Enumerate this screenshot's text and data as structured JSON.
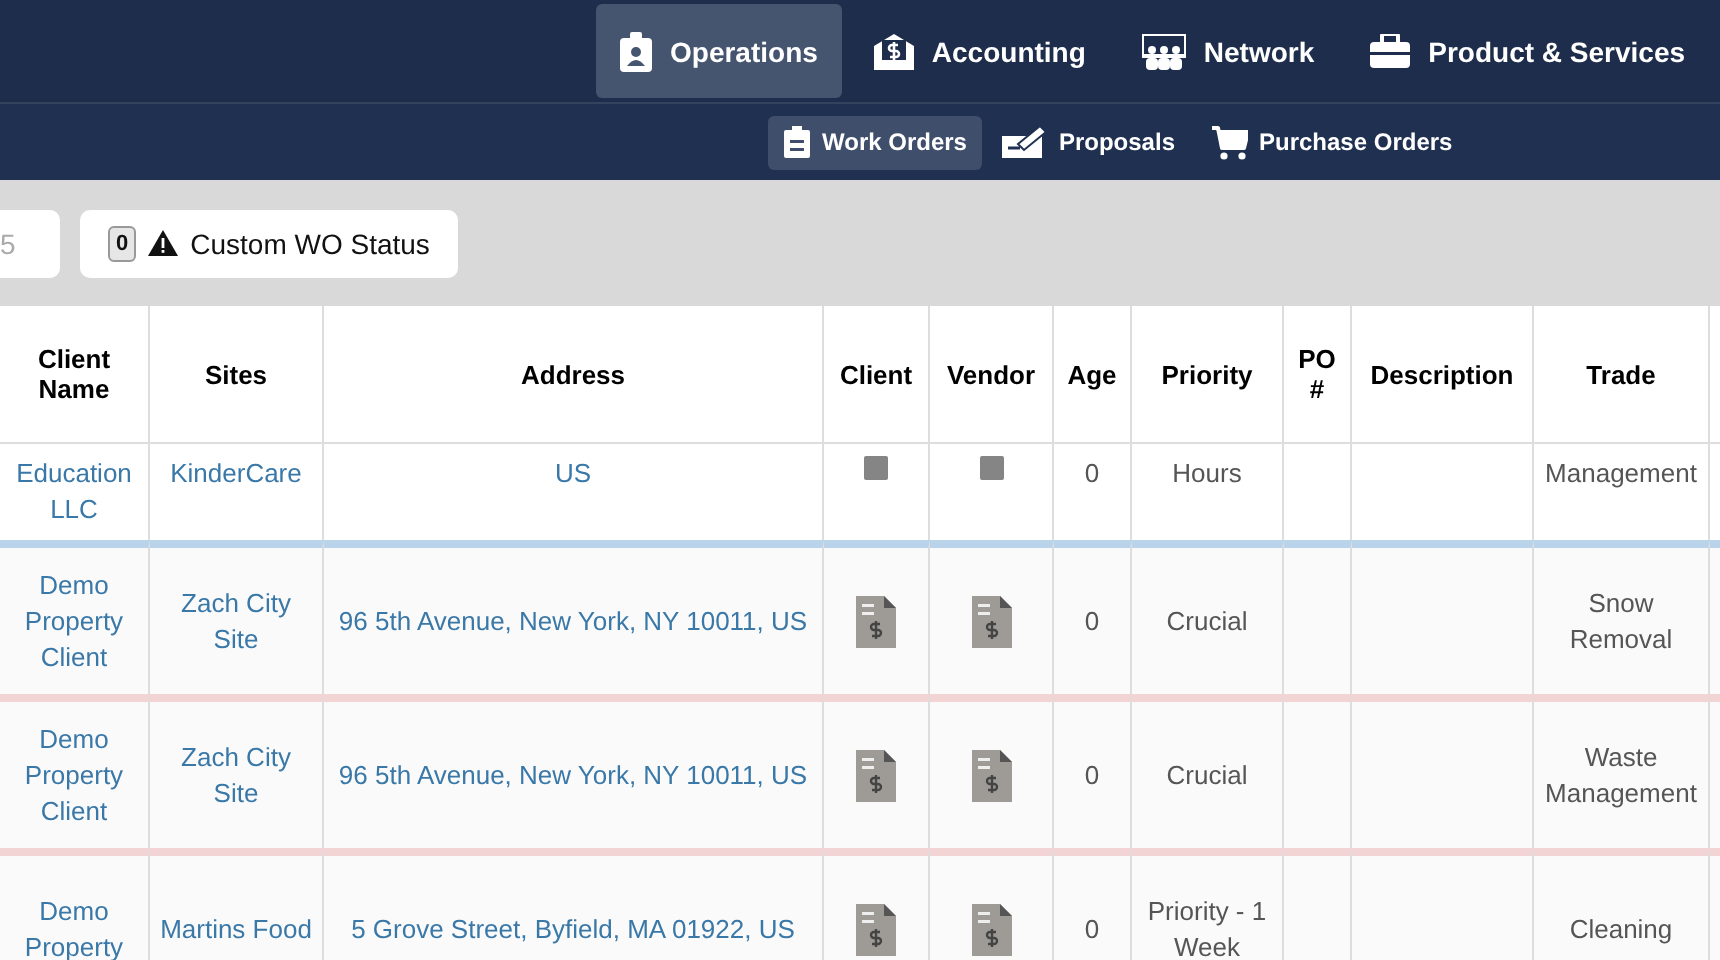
{
  "main_nav": [
    {
      "label": "Operations",
      "selected": true
    },
    {
      "label": "Accounting",
      "selected": false
    },
    {
      "label": "Network",
      "selected": false
    },
    {
      "label": "Product & Services",
      "selected": false
    }
  ],
  "sub_nav": [
    {
      "label": "Work Orders",
      "selected": true
    },
    {
      "label": "Proposals",
      "selected": false
    },
    {
      "label": "Purchase Orders",
      "selected": false
    }
  ],
  "filters": {
    "field_value": "5",
    "status_count": "0",
    "status_label": "Custom WO Status"
  },
  "table": {
    "columns": [
      "Client Name",
      "Sites",
      "Address",
      "Client",
      "Vendor",
      "Age",
      "Priority",
      "PO #",
      "Description",
      "Trade"
    ],
    "rows": [
      {
        "kind": "plain",
        "client_name": "Education LLC",
        "site": "KinderCare",
        "address": "US",
        "age": "0",
        "priority": "Hours",
        "po": "",
        "description": "",
        "trade": "Management"
      },
      {
        "kind": "invoice",
        "color": "#b9d3ea",
        "client_name": "Demo Property Client",
        "site": "Zach City Site",
        "address": "96 5th Avenue, New York, NY 10011, US",
        "age": "0",
        "priority": "Crucial",
        "po": "",
        "description": "",
        "trade": "Snow Removal"
      },
      {
        "kind": "invoice",
        "color": "#f2d4d4",
        "client_name": "Demo Property Client",
        "site": "Zach City Site",
        "address": "96 5th Avenue, New York, NY 10011, US",
        "age": "0",
        "priority": "Crucial",
        "po": "",
        "description": "",
        "trade": "Waste Management"
      },
      {
        "kind": "invoice",
        "color": "#f2d4d4",
        "client_name": "Demo Property",
        "site": "Martins Food",
        "address": "5 Grove Street, Byfield, MA 01922, US",
        "age": "0",
        "priority": "Priority - 1 Week",
        "po": "",
        "description": "",
        "trade": "Cleaning"
      }
    ]
  }
}
